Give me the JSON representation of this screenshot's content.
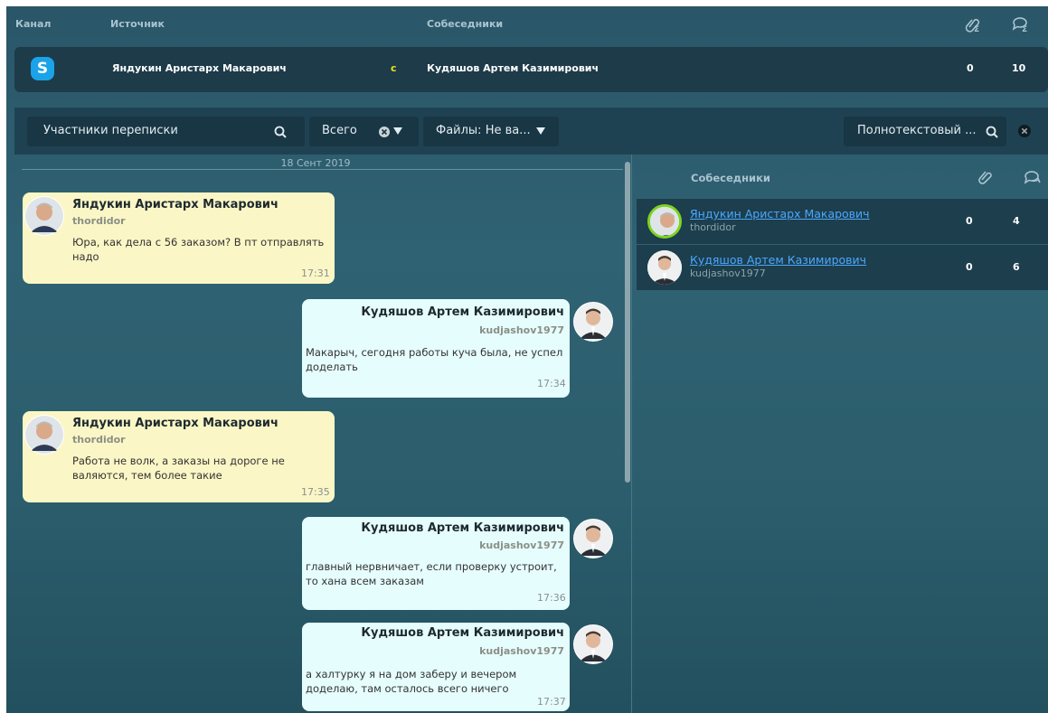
{
  "header": {
    "col_channel": "Канал",
    "col_source": "Источник",
    "col_participants": "Собеседники"
  },
  "channel_row": {
    "icon": "skype-icon",
    "source": "Яндукин Аристарх Макарович",
    "with_label": "с",
    "participant": "Кудяшов Артем Казимирович",
    "attachments_count": "0",
    "messages_count": "10"
  },
  "filters": {
    "participants_placeholder": "Участники переписки",
    "scope_value": "Всего",
    "files_value": "Файлы: Не ва...",
    "fulltext_placeholder": "Полнотекстовый ..."
  },
  "messages": {
    "date": "18 Сент 2019",
    "items": [
      {
        "side": "left",
        "name": "Яндукин Аристарх Макарович",
        "user": "thordidor",
        "text": "Юра, как дела с 56 заказом? В пт отправлять надо",
        "time": "17:31"
      },
      {
        "side": "right",
        "name": "Кудяшов Артем Казимирович",
        "user": "kudjashov1977",
        "text": "Макарыч, сегодня работы куча была, не успел доделать",
        "time": "17:34"
      },
      {
        "side": "left",
        "name": "Яндукин Аристарх Макарович",
        "user": "thordidor",
        "text": "Работа не волк, а заказы на дороге не валяются, тем более такие",
        "time": "17:35"
      },
      {
        "side": "right",
        "name": "Кудяшов Артем Казимирович",
        "user": "kudjashov1977",
        "text": "главный нервничает, если проверку устроит, то хана всем заказам",
        "time": "17:36"
      },
      {
        "side": "right",
        "name": "Кудяшов Артем Казимирович",
        "user": "kudjashov1977",
        "text": "а халтурку я на дом заберу и вечером доделаю, там осталось всего ничего",
        "time": "17:37"
      }
    ]
  },
  "participants": {
    "title": "Собеседники",
    "rows": [
      {
        "name": "Яндукин Аристарх Макарович",
        "user": "thordidor",
        "files": "0",
        "messages": "4"
      },
      {
        "name": "Кудяшов Артем Казимирович",
        "user": "kudjashov1977",
        "files": "0",
        "messages": "6"
      }
    ]
  },
  "colors": {
    "left_bubble": "#fbf6c5",
    "right_bubble": "#e6fdfd",
    "link": "#4aa8ff",
    "skype": "#1aa3e8",
    "active_ring": "#7ed321"
  }
}
